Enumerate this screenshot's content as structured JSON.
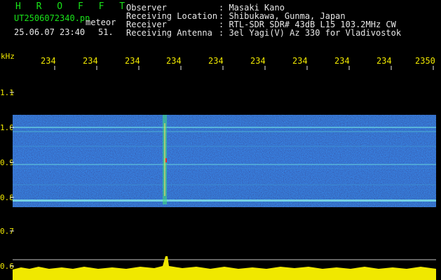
{
  "header": {
    "app_name": "H R O F F T",
    "file_name": "UT2506072340.pn",
    "file_suffix": "meteor",
    "datetime": "25.06.07 23:40",
    "counter": "51.",
    "info_labels": [
      "Observer",
      "Receiving Location",
      "Receiver",
      "Receiving Antenna"
    ],
    "info_values": [
      ": Masaki Kano",
      ": Shibukawa, Gunma, Japan",
      ": RTL-SDR SDR# 43dB L15 103.2MHz CW",
      ": 3el Yagi(V) Az 330 for Vladivostok"
    ]
  },
  "axes": {
    "y_unit": "kHz",
    "x_ticks": [
      "234",
      "234",
      "234",
      "234",
      "234",
      "234",
      "234",
      "234",
      "234",
      "2350"
    ],
    "y_ticks": [
      "1.1",
      "1.0",
      "0.9",
      "0.8",
      "0.7",
      "0.6"
    ]
  },
  "colors": {
    "background": "#000000",
    "header_green": "#19e319",
    "text_white": "#e8e8e8",
    "axis_yellow": "#f0e800",
    "spectrogram_base": "#0a2a9a"
  }
}
